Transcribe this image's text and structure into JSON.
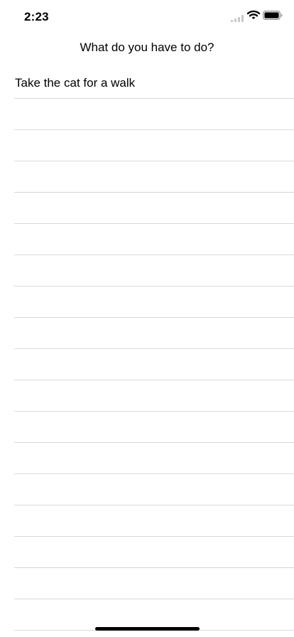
{
  "status_bar": {
    "time": "2:23",
    "icons": [
      "signal-icon",
      "wifi-icon",
      "battery-icon"
    ]
  },
  "navigation": {
    "title": "What do you have to do?"
  },
  "todos": [
    "Take the cat for a walk",
    "",
    "",
    "",
    "",
    "",
    "",
    "",
    "",
    "",
    "",
    "",
    "",
    "",
    "",
    "",
    "",
    ""
  ],
  "colors": {
    "background": "#ffffff",
    "text": "#000000",
    "separator": "#d9d9de"
  }
}
